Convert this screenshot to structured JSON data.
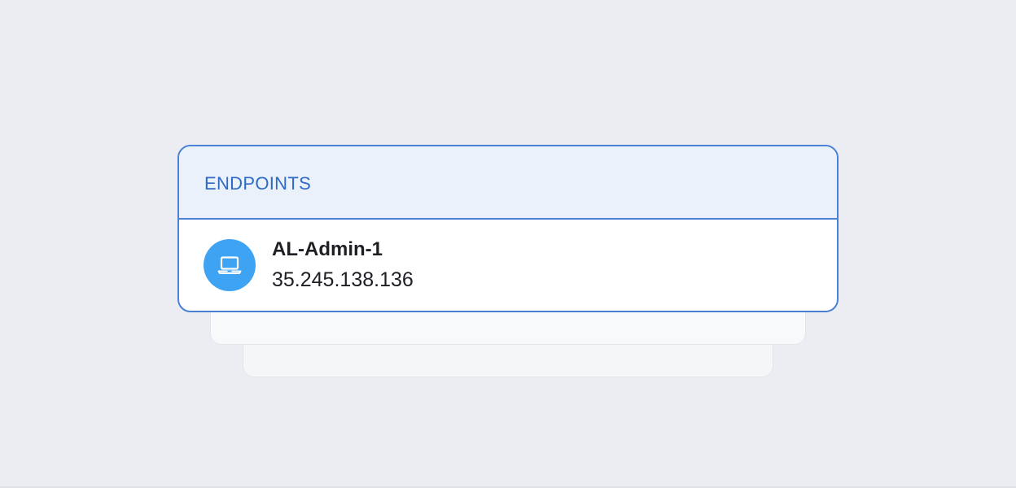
{
  "panel": {
    "title": "ENDPOINTS"
  },
  "endpoints": [
    {
      "name": "AL-Admin-1",
      "ip": "35.245.138.136",
      "icon": "laptop-icon"
    }
  ],
  "colors": {
    "accent": "#4a80d6",
    "header_bg": "#eaf1fb",
    "icon_bg": "#3fa3f3",
    "page_bg": "#ebedf2"
  }
}
